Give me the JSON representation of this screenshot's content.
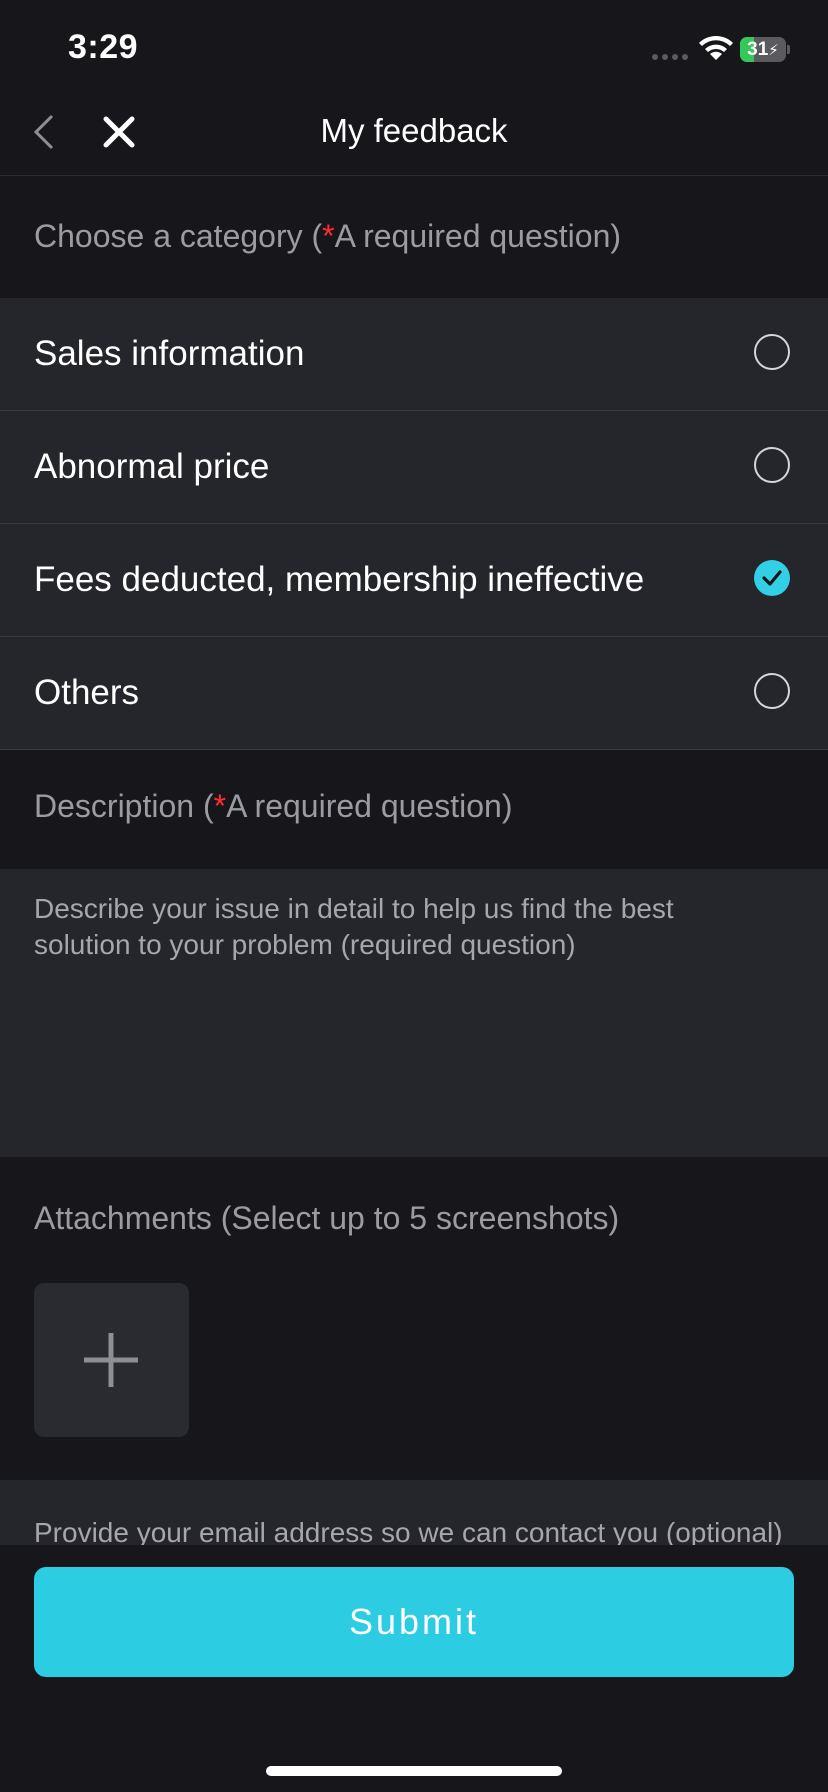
{
  "status_bar": {
    "time": "3:29",
    "battery": "31",
    "battery_level": 0.31,
    "battery_color": "#34c759"
  },
  "nav": {
    "title": "My feedback",
    "back_icon": "chevron-left-icon",
    "close_icon": "close-icon"
  },
  "category": {
    "label_prefix": "Choose a category (",
    "required_star": "*",
    "label_suffix": "A required question)",
    "options": [
      {
        "label": "Sales information",
        "selected": false
      },
      {
        "label": "Abnormal price",
        "selected": false
      },
      {
        "label": "Fees deducted, membership ineffective",
        "selected": true
      },
      {
        "label": "Others",
        "selected": false
      }
    ]
  },
  "description": {
    "label_prefix": "Description (",
    "required_star": "*",
    "label_suffix": "A required question)",
    "placeholder": "Describe your issue in detail to help us find the best solution to your problem (required question)"
  },
  "attachments": {
    "label": "Attachments (Select up to 5 screenshots)",
    "add_icon": "plus-icon"
  },
  "email": {
    "placeholder": "Provide your email address so we can contact you (optional)"
  },
  "submit_label": "Submit",
  "colors": {
    "accent": "#2ccce3",
    "background": "#16161b",
    "surface": "#25252c",
    "required": "#ff2d2d"
  }
}
